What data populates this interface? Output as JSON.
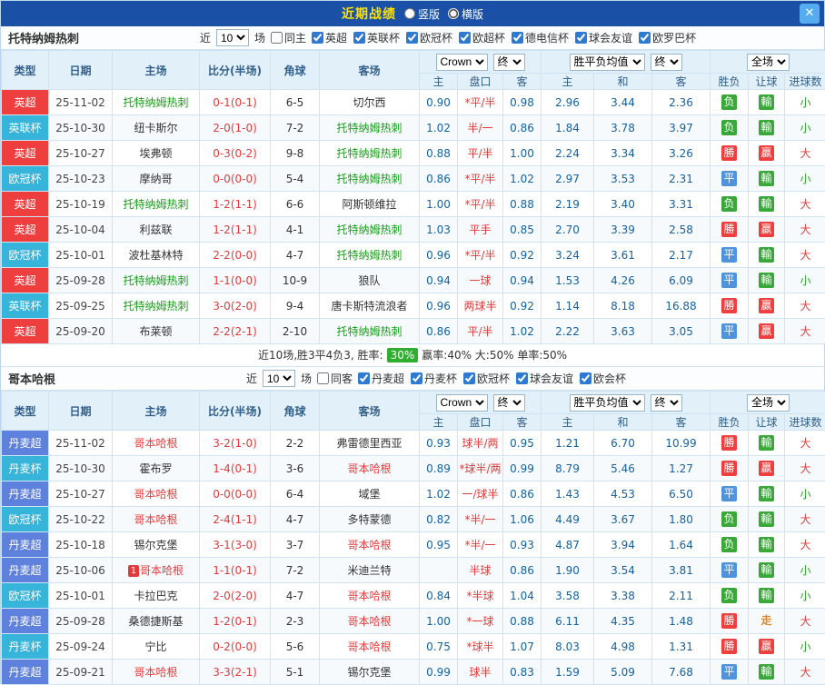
{
  "titlebar": {
    "title": "近期战绩",
    "layout_vertical": "竖版",
    "layout_horizontal": "横版",
    "vertical_checked": false,
    "horizontal_checked": true,
    "close_icon": "✕"
  },
  "table_header": {
    "type": "类型",
    "date": "日期",
    "home": "主场",
    "score": "比分(半场)",
    "corner": "角球",
    "away": "客场",
    "odds_source": "Crown",
    "odds_final": "终",
    "avg_title": "胜平负均值",
    "avg_final": "终",
    "scope": "全场",
    "sub": [
      "主",
      "盘口",
      "客",
      "主",
      "和",
      "客",
      "胜负",
      "让球",
      "进球数"
    ]
  },
  "league_colors": {
    "英超": "#ef3e3e",
    "英联杯": "#36b4d9",
    "欧冠杯": "#36b4d9",
    "丹麦超": "#5f81de",
    "丹麦杯": "#36b4d9"
  },
  "badge_colors": {
    "勝": "#ef3e3e",
    "负": "#39a839",
    "平": "#4f93dc",
    "贏": "#ef3e3e",
    "輸": "#39a839",
    "走": "#e2862a"
  },
  "text_results": [
    "走"
  ],
  "goals_colors": {
    "大": "#e73c3c",
    "小": "#2ca32c"
  },
  "sections": [
    {
      "team": "托特纳姆热刺",
      "highlight_color": "#18a018",
      "near_label": "近",
      "match_count": "10",
      "unit_label": "场",
      "venue_filter": {
        "label": "同主",
        "checked": false
      },
      "leagues": [
        {
          "label": "英超",
          "checked": true
        },
        {
          "label": "英联杯",
          "checked": true
        },
        {
          "label": "欧冠杯",
          "checked": true
        },
        {
          "label": "欧超杯",
          "checked": true
        },
        {
          "label": "德电信杯",
          "checked": true
        },
        {
          "label": "球会友谊",
          "checked": true
        },
        {
          "label": "欧罗巴杯",
          "checked": true
        }
      ],
      "rows": [
        {
          "league": "英超",
          "date": "25-11-02",
          "home": "托特纳姆热刺",
          "score": "0-1(0-1)",
          "corner": "6-5",
          "away": "切尔西",
          "odds_home": "0.90",
          "handicap": "*平/半",
          "odds_away": "0.98",
          "avg_win": "2.96",
          "avg_draw": "3.44",
          "avg_lose": "2.36",
          "result": "负",
          "handicap_result": "輸",
          "goals": "小"
        },
        {
          "league": "英联杯",
          "date": "25-10-30",
          "home": "纽卡斯尔",
          "score": "2-0(1-0)",
          "corner": "7-2",
          "away": "托特纳姆热刺",
          "odds_home": "1.02",
          "handicap": "半/一",
          "odds_away": "0.86",
          "avg_win": "1.84",
          "avg_draw": "3.78",
          "avg_lose": "3.97",
          "result": "负",
          "handicap_result": "輸",
          "goals": "小"
        },
        {
          "league": "英超",
          "date": "25-10-27",
          "home": "埃弗顿",
          "score": "0-3(0-2)",
          "corner": "9-8",
          "away": "托特纳姆热刺",
          "odds_home": "0.88",
          "handicap": "平/半",
          "odds_away": "1.00",
          "avg_win": "2.24",
          "avg_draw": "3.34",
          "avg_lose": "3.26",
          "result": "勝",
          "handicap_result": "贏",
          "goals": "大"
        },
        {
          "league": "欧冠杯",
          "date": "25-10-23",
          "home": "摩纳哥",
          "score": "0-0(0-0)",
          "corner": "5-4",
          "away": "托特纳姆热刺",
          "odds_home": "0.86",
          "handicap": "*平/半",
          "odds_away": "1.02",
          "avg_win": "2.97",
          "avg_draw": "3.53",
          "avg_lose": "2.31",
          "result": "平",
          "handicap_result": "輸",
          "goals": "小"
        },
        {
          "league": "英超",
          "date": "25-10-19",
          "home": "托特纳姆热刺",
          "score": "1-2(1-1)",
          "corner": "6-6",
          "away": "阿斯顿维拉",
          "odds_home": "1.00",
          "handicap": "*平/半",
          "odds_away": "0.88",
          "avg_win": "2.19",
          "avg_draw": "3.40",
          "avg_lose": "3.31",
          "result": "负",
          "handicap_result": "輸",
          "goals": "大"
        },
        {
          "league": "英超",
          "date": "25-10-04",
          "home": "利兹联",
          "score": "1-2(1-1)",
          "corner": "4-1",
          "away": "托特纳姆热刺",
          "odds_home": "1.03",
          "handicap": "平手",
          "odds_away": "0.85",
          "avg_win": "2.70",
          "avg_draw": "3.39",
          "avg_lose": "2.58",
          "result": "勝",
          "handicap_result": "贏",
          "goals": "大"
        },
        {
          "league": "欧冠杯",
          "date": "25-10-01",
          "home": "波杜基林特",
          "score": "2-2(0-0)",
          "corner": "4-7",
          "away": "托特纳姆热刺",
          "odds_home": "0.96",
          "handicap": "*平/半",
          "odds_away": "0.92",
          "avg_win": "3.24",
          "avg_draw": "3.61",
          "avg_lose": "2.17",
          "result": "平",
          "handicap_result": "輸",
          "goals": "大"
        },
        {
          "league": "英超",
          "date": "25-09-28",
          "home": "托特纳姆热刺",
          "score": "1-1(0-0)",
          "corner": "10-9",
          "away": "狼队",
          "odds_home": "0.94",
          "handicap": "一球",
          "odds_away": "0.94",
          "avg_win": "1.53",
          "avg_draw": "4.26",
          "avg_lose": "6.09",
          "result": "平",
          "handicap_result": "輸",
          "goals": "小"
        },
        {
          "league": "英联杯",
          "date": "25-09-25",
          "home": "托特纳姆热刺",
          "score": "3-0(2-0)",
          "corner": "9-4",
          "away": "唐卡斯特流浪者",
          "odds_home": "0.96",
          "handicap": "两球半",
          "odds_away": "0.92",
          "avg_win": "1.14",
          "avg_draw": "8.18",
          "avg_lose": "16.88",
          "result": "勝",
          "handicap_result": "贏",
          "goals": "大"
        },
        {
          "league": "英超",
          "date": "25-09-20",
          "home": "布莱顿",
          "score": "2-2(2-1)",
          "corner": "2-10",
          "away": "托特纳姆热刺",
          "odds_home": "0.86",
          "handicap": "平/半",
          "odds_away": "1.02",
          "avg_win": "2.22",
          "avg_draw": "3.63",
          "avg_lose": "3.05",
          "result": "平",
          "handicap_result": "贏",
          "goals": "大"
        }
      ],
      "summary": {
        "prefix": "近10场,胜3平4负3, 胜率:",
        "win_rate": "30%",
        "suffix": "赢率:40% 大:50% 单率:50%"
      }
    },
    {
      "team": "哥本哈根",
      "highlight_color": "#e73c3c",
      "near_label": "近",
      "match_count": "10",
      "unit_label": "场",
      "venue_filter": {
        "label": "同客",
        "checked": false
      },
      "leagues": [
        {
          "label": "丹麦超",
          "checked": true
        },
        {
          "label": "丹麦杯",
          "checked": true
        },
        {
          "label": "欧冠杯",
          "checked": true
        },
        {
          "label": "球会友谊",
          "checked": true
        },
        {
          "label": "欧会杯",
          "checked": true
        }
      ],
      "rows": [
        {
          "league": "丹麦超",
          "date": "25-11-02",
          "home": "哥本哈根",
          "score": "3-2(1-0)",
          "corner": "2-2",
          "away": "弗雷德里西亚",
          "odds_home": "0.93",
          "handicap": "球半/两",
          "odds_away": "0.95",
          "avg_win": "1.21",
          "avg_draw": "6.70",
          "avg_lose": "10.99",
          "result": "勝",
          "handicap_result": "輸",
          "goals": "大"
        },
        {
          "league": "丹麦杯",
          "date": "25-10-30",
          "home": "霍布罗",
          "score": "1-4(0-1)",
          "corner": "3-6",
          "away": "哥本哈根",
          "odds_home": "0.89",
          "handicap": "*球半/两",
          "odds_away": "0.99",
          "avg_win": "8.79",
          "avg_draw": "5.46",
          "avg_lose": "1.27",
          "result": "勝",
          "handicap_result": "贏",
          "goals": "大"
        },
        {
          "league": "丹麦超",
          "date": "25-10-27",
          "home": "哥本哈根",
          "score": "0-0(0-0)",
          "corner": "6-4",
          "away": "域堡",
          "odds_home": "1.02",
          "handicap": "一/球半",
          "odds_away": "0.86",
          "avg_win": "1.43",
          "avg_draw": "4.53",
          "avg_lose": "6.50",
          "result": "平",
          "handicap_result": "輸",
          "goals": "小"
        },
        {
          "league": "欧冠杯",
          "date": "25-10-22",
          "home": "哥本哈根",
          "score": "2-4(1-1)",
          "corner": "4-7",
          "away": "多特蒙德",
          "odds_home": "0.82",
          "handicap": "*半/一",
          "odds_away": "1.06",
          "avg_win": "4.49",
          "avg_draw": "3.67",
          "avg_lose": "1.80",
          "result": "负",
          "handicap_result": "輸",
          "goals": "大"
        },
        {
          "league": "丹麦超",
          "date": "25-10-18",
          "home": "锡尔克堡",
          "score": "3-1(3-0)",
          "corner": "3-7",
          "away": "哥本哈根",
          "odds_home": "0.95",
          "handicap": "*半/一",
          "odds_away": "0.93",
          "avg_win": "4.87",
          "avg_draw": "3.94",
          "avg_lose": "1.64",
          "result": "负",
          "handicap_result": "輸",
          "goals": "大"
        },
        {
          "league": "丹麦超",
          "date": "25-10-06",
          "home": "哥本哈根",
          "home_badge": "1",
          "score": "1-1(0-1)",
          "corner": "7-2",
          "away": "米迪兰特",
          "odds_home": "",
          "handicap": "半球",
          "odds_away": "0.86",
          "avg_win": "1.90",
          "avg_draw": "3.54",
          "avg_lose": "3.81",
          "result": "平",
          "handicap_result": "輸",
          "goals": "小"
        },
        {
          "league": "欧冠杯",
          "date": "25-10-01",
          "home": "卡拉巴克",
          "score": "2-0(2-0)",
          "corner": "4-7",
          "away": "哥本哈根",
          "odds_home": "0.84",
          "handicap": "*半球",
          "odds_away": "1.04",
          "avg_win": "3.58",
          "avg_draw": "3.38",
          "avg_lose": "2.11",
          "result": "负",
          "handicap_result": "輸",
          "goals": "小"
        },
        {
          "league": "丹麦超",
          "date": "25-09-28",
          "home": "桑德捷斯基",
          "score": "1-2(0-1)",
          "corner": "2-3",
          "away": "哥本哈根",
          "odds_home": "1.00",
          "handicap": "*一球",
          "odds_away": "0.88",
          "avg_win": "6.11",
          "avg_draw": "4.35",
          "avg_lose": "1.48",
          "result": "勝",
          "handicap_result": "走",
          "goals": "大"
        },
        {
          "league": "丹麦杯",
          "date": "25-09-24",
          "home": "宁比",
          "score": "0-2(0-0)",
          "corner": "5-6",
          "away": "哥本哈根",
          "odds_home": "0.75",
          "handicap": "*球半",
          "odds_away": "1.07",
          "avg_win": "8.03",
          "avg_draw": "4.98",
          "avg_lose": "1.31",
          "result": "勝",
          "handicap_result": "贏",
          "goals": "小"
        },
        {
          "league": "丹麦超",
          "date": "25-09-21",
          "home": "哥本哈根",
          "score": "3-3(2-1)",
          "corner": "5-1",
          "away": "锡尔克堡",
          "odds_home": "0.99",
          "handicap": "球半",
          "odds_away": "0.83",
          "avg_win": "1.59",
          "avg_draw": "5.09",
          "avg_lose": "7.68",
          "result": "平",
          "handicap_result": "輸",
          "goals": "大"
        }
      ],
      "summary": null
    }
  ]
}
